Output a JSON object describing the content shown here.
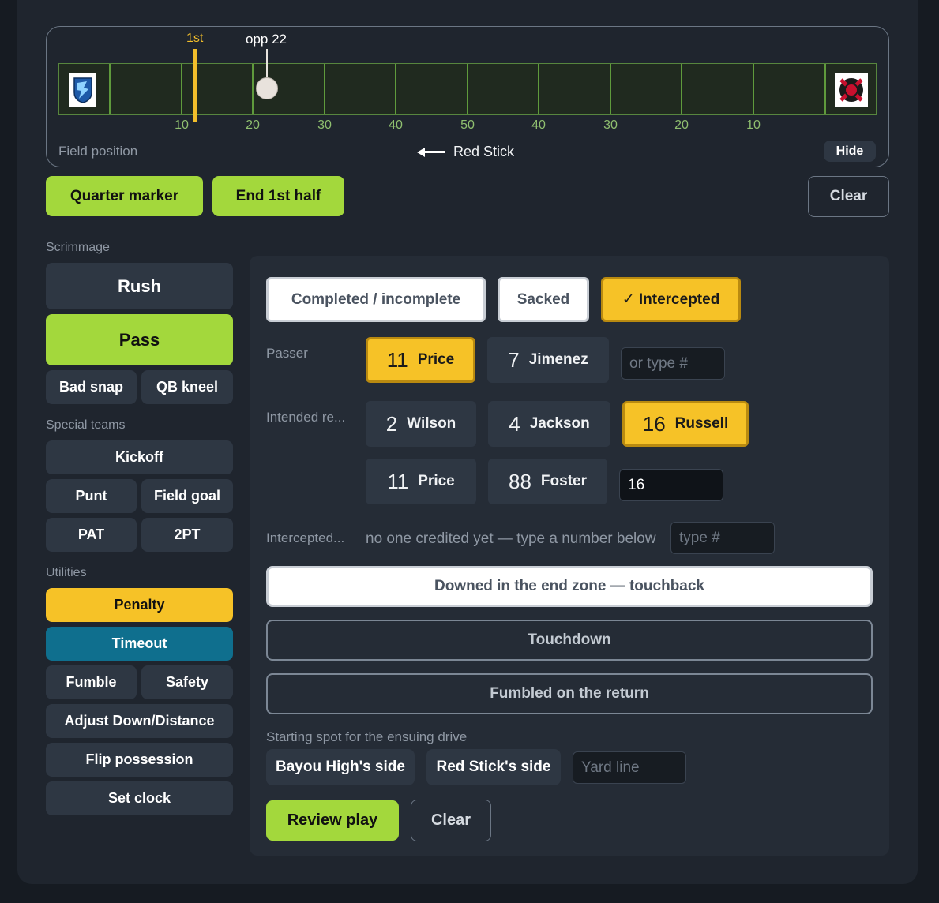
{
  "field": {
    "first_down_label": "1st",
    "ball_label": "opp 22",
    "yard_numbers": [
      "10",
      "20",
      "30",
      "40",
      "50",
      "40",
      "30",
      "20",
      "10"
    ],
    "caption": "Field position",
    "direction_team": "Red Stick",
    "hide_label": "Hide",
    "colors": {
      "turf": "#202a1f",
      "lines": "#5f9a3c",
      "first_down": "#f2be2b"
    }
  },
  "top_actions": {
    "quarter_marker": "Quarter marker",
    "end_half": "End 1st half",
    "clear": "Clear"
  },
  "sidebar": {
    "scrimmage_label": "Scrimmage",
    "rush": "Rush",
    "pass": "Pass",
    "bad_snap": "Bad snap",
    "qb_kneel": "QB kneel",
    "special_teams_label": "Special teams",
    "kickoff": "Kickoff",
    "punt": "Punt",
    "field_goal": "Field goal",
    "pat": "PAT",
    "two_pt": "2PT",
    "utilities_label": "Utilities",
    "penalty": "Penalty",
    "timeout": "Timeout",
    "fumble": "Fumble",
    "safety": "Safety",
    "adjust": "Adjust Down/Distance",
    "flip": "Flip possession",
    "set_clock": "Set clock"
  },
  "pass_form": {
    "modes": {
      "completed": "Completed / incomplete",
      "sacked": "Sacked",
      "intercepted": "✓ Intercepted"
    },
    "passer_label": "Passer",
    "passers": [
      {
        "num": "11",
        "name": "Price"
      },
      {
        "num": "7",
        "name": "Jimenez"
      }
    ],
    "passer_placeholder": "or type #",
    "receiver_label": "Intended re...",
    "receivers": [
      {
        "num": "2",
        "name": "Wilson"
      },
      {
        "num": "4",
        "name": "Jackson"
      },
      {
        "num": "16",
        "name": "Russell"
      },
      {
        "num": "11",
        "name": "Price"
      },
      {
        "num": "88",
        "name": "Foster"
      }
    ],
    "receiver_value": "16",
    "intercepted_label": "Intercepted...",
    "intercepted_note": "no one credited yet — type a number below",
    "intercepted_placeholder": "type #",
    "touchback": "Downed in the end zone — touchback",
    "touchdown": "Touchdown",
    "fumbled_return": "Fumbled on the return",
    "starting_spot_label": "Starting spot for the ensuing drive",
    "home_side": "Bayou High's side",
    "away_side": "Red Stick's side",
    "yard_line_placeholder": "Yard line",
    "review": "Review play",
    "clear": "Clear"
  }
}
